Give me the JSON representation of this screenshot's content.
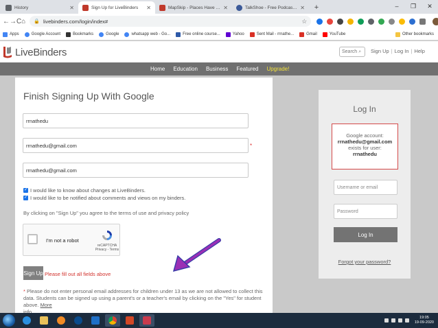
{
  "browser": {
    "tabs": [
      {
        "title": "History",
        "active": false,
        "favicon_color": "#5f6368"
      },
      {
        "title": "Sign Up for LiveBinders",
        "active": true,
        "favicon_color": "#c0392b"
      },
      {
        "title": "MapSkip - Places Have Stories!",
        "active": false,
        "favicon_color": "#c0392b"
      },
      {
        "title": "TalkShoe - Free Podcast Platform",
        "active": false,
        "favicon_color": "#3b5998"
      }
    ],
    "new_tab": "+",
    "window_controls": [
      "–",
      "❐",
      "✕"
    ],
    "url": "livebinders.com/login/index#",
    "nav": {
      "back": "←",
      "forward": "→",
      "reload": "C",
      "home": "⌂"
    },
    "bookmarks": [
      {
        "label": "Apps",
        "color": "#4285f4"
      },
      {
        "label": "Google Account",
        "color": "#4285f4"
      },
      {
        "label": "Bookmarks",
        "color": "#333333"
      },
      {
        "label": "Google",
        "color": "#4285f4"
      },
      {
        "label": "whatsapp web - Go...",
        "color": "#4285f4"
      },
      {
        "label": "Free online course...",
        "color": "#2e5aa8"
      },
      {
        "label": "Yahoo",
        "color": "#6001d2"
      },
      {
        "label": "Sent Mail - rrnathe...",
        "color": "#d93025"
      },
      {
        "label": "Gmail",
        "color": "#d93025"
      },
      {
        "label": "YouTube",
        "color": "#ff0000"
      }
    ],
    "other_bookmarks": "Other bookmarks"
  },
  "site": {
    "logo_text": "LiveBinders",
    "search_label": "Search",
    "top_links": [
      "Sign Up",
      "Log In",
      "Help"
    ],
    "nav": [
      "Home",
      "Education",
      "Business",
      "Featured",
      "Upgrade!"
    ],
    "nav_highlight_color": "#f3e23a"
  },
  "signup": {
    "title": "Finish Signing Up With Google",
    "username_value": "rrnathedu",
    "email_value": "rrnathedu@gmail.com",
    "confirm_email_value": "rrnathedu@gmail.com",
    "required_marker": "*",
    "checkbox_1": "I would like to know about changes at LiveBinders.",
    "checkbox_2": "I would like to be notified about comments and views on my binders.",
    "terms_text": "By clicking on \"Sign Up\" you agree to the terms of use and privacy policy",
    "captcha_label": "I'm not a robot",
    "captcha_brand": "reCAPTCHA",
    "captcha_links": "Privacy - Terms",
    "signup_button": "Sign Up",
    "error_text": "Please fill out all fields above",
    "notice_marker": "*",
    "notice_text": " Please do not enter personal email addresses for children under 13 as we are not allowed to collect this data. Students can be signed up using a parent's or a teacher's email by clicking on the \"Yes\" for student above. ",
    "notice_more": "More",
    "notice_tail": "info"
  },
  "login": {
    "title": "Log In",
    "google_account_label": "Google account:",
    "google_account_email": "rrnathedu@gmail.com",
    "exists_label": "exists for user:",
    "existing_user": "rrnathedu",
    "username_placeholder": "Username or email",
    "password_placeholder": "Password",
    "login_button": "Log In",
    "forgot_link": "Forgot your password?"
  },
  "taskbar": {
    "time": "19:05",
    "date": "19-09-2020"
  }
}
